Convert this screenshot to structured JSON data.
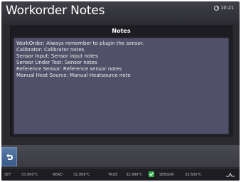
{
  "window": {
    "title": "Workorder Notes",
    "clock": "10:21"
  },
  "notes_panel": {
    "header": "Notes",
    "lines": [
      "WorkOrder: Always remember to plugin the sensor.",
      "Calibrator: Calibrator notes",
      "Sensor Input: Sensor input notes",
      "Sensor Under Test: Sensor notes",
      "Reference Sensor: Reference sensor notes",
      "Manual Heat Source: Manual Heatsource note"
    ]
  },
  "status_bar": {
    "set_label": "SET",
    "set_value": "33.000°C",
    "read_label": "READ",
    "read_value": "32.068°C",
    "true_label": "TRUE",
    "true_value": "32.999°C",
    "sensor_label": "SENSOR",
    "sensor_value": "33.600°C"
  },
  "icons": {
    "back": "back-arrow-icon",
    "clock": "clock-icon",
    "stable": "check-icon",
    "signal": "signal-icon"
  },
  "colors": {
    "accent_blue": "#4a6e9e",
    "stable_green": "#31b04a",
    "notes_bg": "#505068"
  }
}
